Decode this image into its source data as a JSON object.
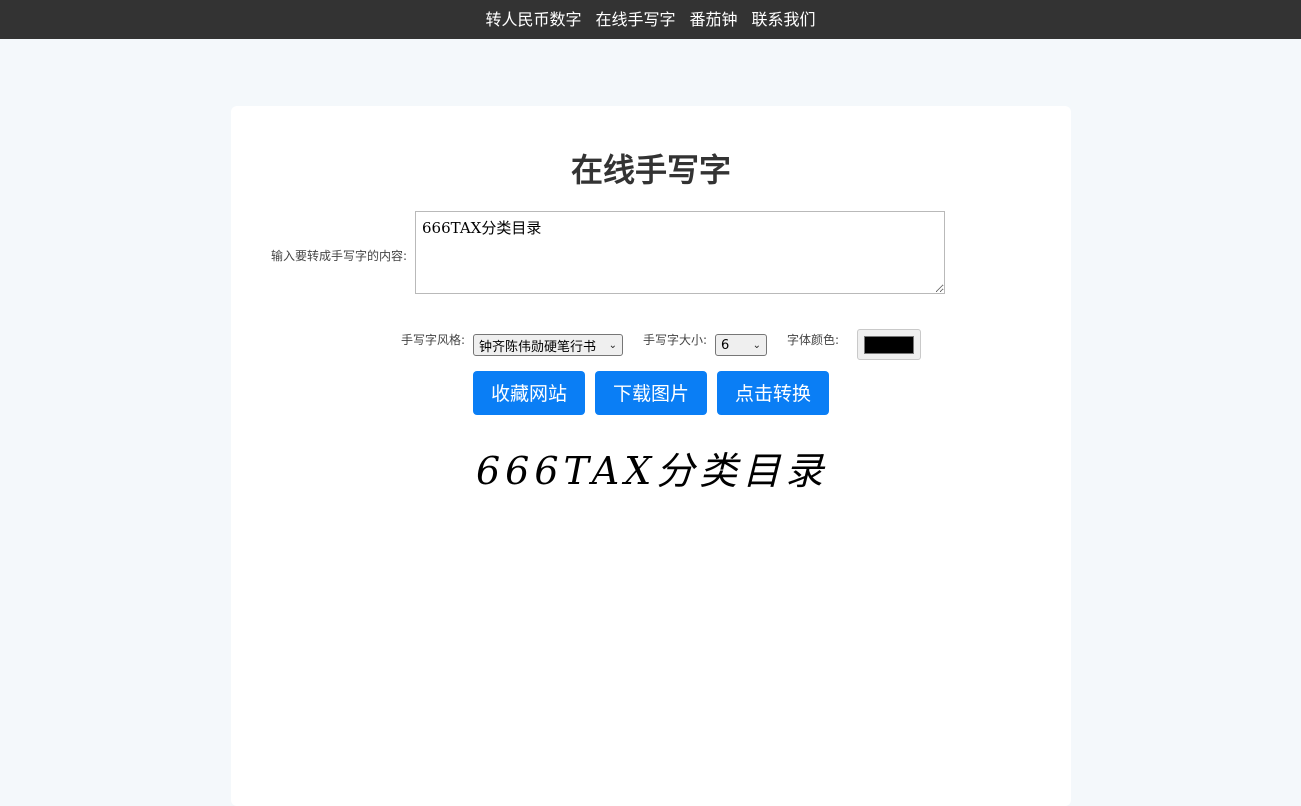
{
  "nav": {
    "items": [
      {
        "label": "转人民币数字"
      },
      {
        "label": "在线手写字"
      },
      {
        "label": "番茄钟"
      },
      {
        "label": "联系我们"
      }
    ]
  },
  "main": {
    "title": "在线手写字",
    "content_label": "输入要转成手写字的内容:",
    "content_value": "666TAX分类目录",
    "style_label": "手写字风格:",
    "style_selected": "钟齐陈伟勋硬笔行书",
    "size_label": "手写字大小:",
    "size_selected": "6",
    "color_label": "字体颜色:",
    "color_value": "#000000",
    "buttons": {
      "bookmark": "收藏网站",
      "download": "下载图片",
      "convert": "点击转换"
    },
    "preview_text": "666TAX分类目录"
  }
}
